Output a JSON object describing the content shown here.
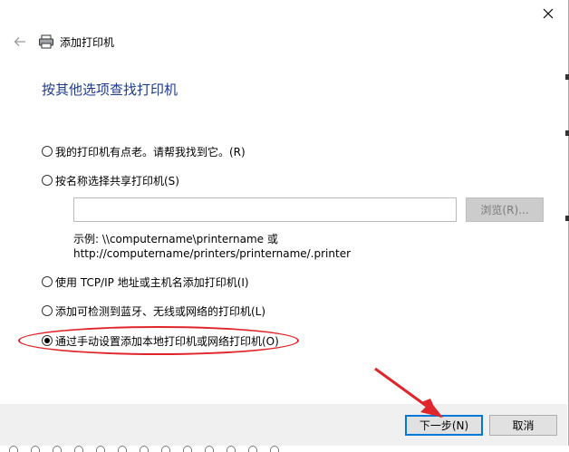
{
  "dialog": {
    "title": "添加打印机",
    "heading": "按其他选项查找打印机"
  },
  "options": [
    {
      "label": "我的打印机有点老。请帮我找到它。(R)",
      "checked": false
    },
    {
      "label": "按名称选择共享打印机(S)",
      "checked": false
    },
    {
      "label": "使用 TCP/IP 地址或主机名添加打印机(I)",
      "checked": false
    },
    {
      "label": "添加可检测到蓝牙、无线或网络的打印机(L)",
      "checked": false
    },
    {
      "label": "通过手动设置添加本地打印机或网络打印机(O)",
      "checked": true
    }
  ],
  "shared_printer": {
    "input_value": "",
    "browse_label": "浏览(R)...",
    "example_line1": "示例: \\\\computername\\printername 或",
    "example_line2": "http://computername/printers/printername/.printer"
  },
  "buttons": {
    "next_label": "下一步(N)",
    "cancel_label": "取消"
  },
  "icons": {
    "close": "close-icon",
    "back": "back-arrow-icon",
    "printer": "printer-icon"
  },
  "colors": {
    "heading": "#1e3b8a",
    "annotation": "#e0262a",
    "focus_border": "#0078d7"
  }
}
